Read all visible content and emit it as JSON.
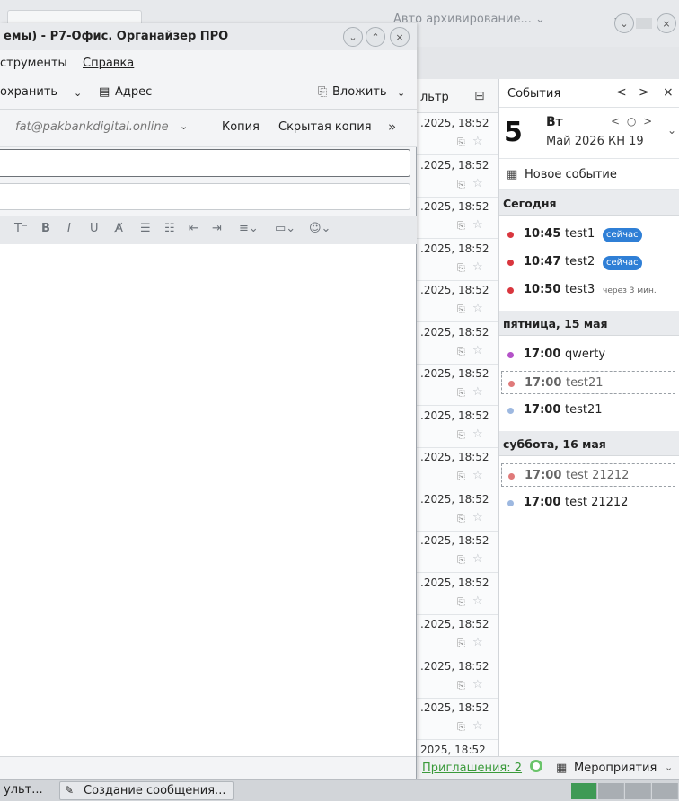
{
  "background_window": {
    "archive_label": "Авто архивирование...",
    "archive_chevron": "⌄",
    "menu_icon": "≡",
    "minimize": "⌄",
    "close": "×"
  },
  "compose": {
    "title": "емы) - Р7-Офис. Органайзер ПРО",
    "window_buttons": {
      "minimize": "⌄",
      "maximize": "⌃",
      "close": "×"
    },
    "menu": {
      "tools": "струменты",
      "help": "Справка"
    },
    "toolbar": {
      "save": "охранить",
      "save_dropdown": "⌄",
      "address_icon": "▤",
      "address": "Адрес",
      "attach_icon": "⎘",
      "attach": "Вложить",
      "attach_dropdown": "⌄"
    },
    "from": {
      "value": "fat@pakbankdigital.online",
      "chevron": "⌄",
      "copy": "Копия",
      "bcc": "Скрытая копия",
      "more": "»"
    },
    "to_value": "",
    "subject_value": "",
    "format": {
      "font_size": "T⁻",
      "bold": "B",
      "italic": "I",
      "underline": "U",
      "clear": "A̸",
      "bulleted": "☰",
      "numbered": "☷",
      "outdent": "⇤",
      "indent": "⇥",
      "align": "≡⌄",
      "insert": "▭⌄",
      "emoji": "☺⌄"
    }
  },
  "message_list": {
    "column_label": "льтр",
    "column_icon": "⊟",
    "clip": "⎘",
    "star": "☆",
    "rows": [
      ".2025, 18:52",
      ".2025, 18:52",
      ".2025, 18:52",
      ".2025, 18:52",
      ".2025, 18:52",
      ".2025, 18:52",
      ".2025, 18:52",
      ".2025, 18:52",
      ".2025, 18:52",
      ".2025, 18:52",
      ".2025, 18:52",
      ".2025, 18:52",
      ".2025, 18:52",
      ".2025, 18:52",
      ".2025, 18:52",
      "2025, 18:52"
    ]
  },
  "events": {
    "title": "События",
    "prev": "<",
    "next": ">",
    "close": "×",
    "day_number": "5",
    "day_name": "Вт",
    "month_week": "Май 2026  КН 19",
    "mini_nav": "< ○ >",
    "collapse": "⌄",
    "new_event_icon": "▦",
    "new_event": "Новое событие",
    "sections": [
      {
        "label": "Сегодня",
        "items": [
          {
            "time": "10:45",
            "name": "test1",
            "badge": "сейчас",
            "note": "",
            "color": "#d9363e",
            "dashed": false
          },
          {
            "time": "10:47",
            "name": "test2",
            "badge": "сейчас",
            "note": "",
            "color": "#d9363e",
            "dashed": false
          },
          {
            "time": "10:50",
            "name": "test3",
            "badge": "",
            "note": "через 3 мин.",
            "color": "#d9363e",
            "dashed": false
          }
        ]
      },
      {
        "label": "пятница, 15 мая",
        "items": [
          {
            "time": "17:00",
            "name": "qwerty",
            "badge": "",
            "note": "",
            "color": "#b452c8",
            "dashed": false
          },
          {
            "time": "17:00",
            "name": "test21",
            "badge": "",
            "note": "",
            "color": "#e07a7a",
            "dashed": true
          },
          {
            "time": "17:00",
            "name": "test21",
            "badge": "",
            "note": "",
            "color": "#9db8e0",
            "dashed": false
          }
        ]
      },
      {
        "label": "суббота, 16 мая",
        "items": [
          {
            "time": "17:00",
            "name": "test 21212",
            "badge": "",
            "note": "",
            "color": "#e07a7a",
            "dashed": true
          },
          {
            "time": "17:00",
            "name": "test 21212",
            "badge": "",
            "note": "",
            "color": "#9db8e0",
            "dashed": false
          }
        ]
      }
    ]
  },
  "status": {
    "invitations": "Приглашения: 2",
    "meetings_icon": "▦",
    "meetings": "Мероприятия",
    "meetings_chevron": "⌄"
  },
  "taskbar": {
    "item1": "ульт...",
    "item2_icon": "✎",
    "item2": "Создание сообщения..."
  },
  "colors": {
    "accent": "#2f7fd6",
    "invites": "#3a9a3a"
  }
}
